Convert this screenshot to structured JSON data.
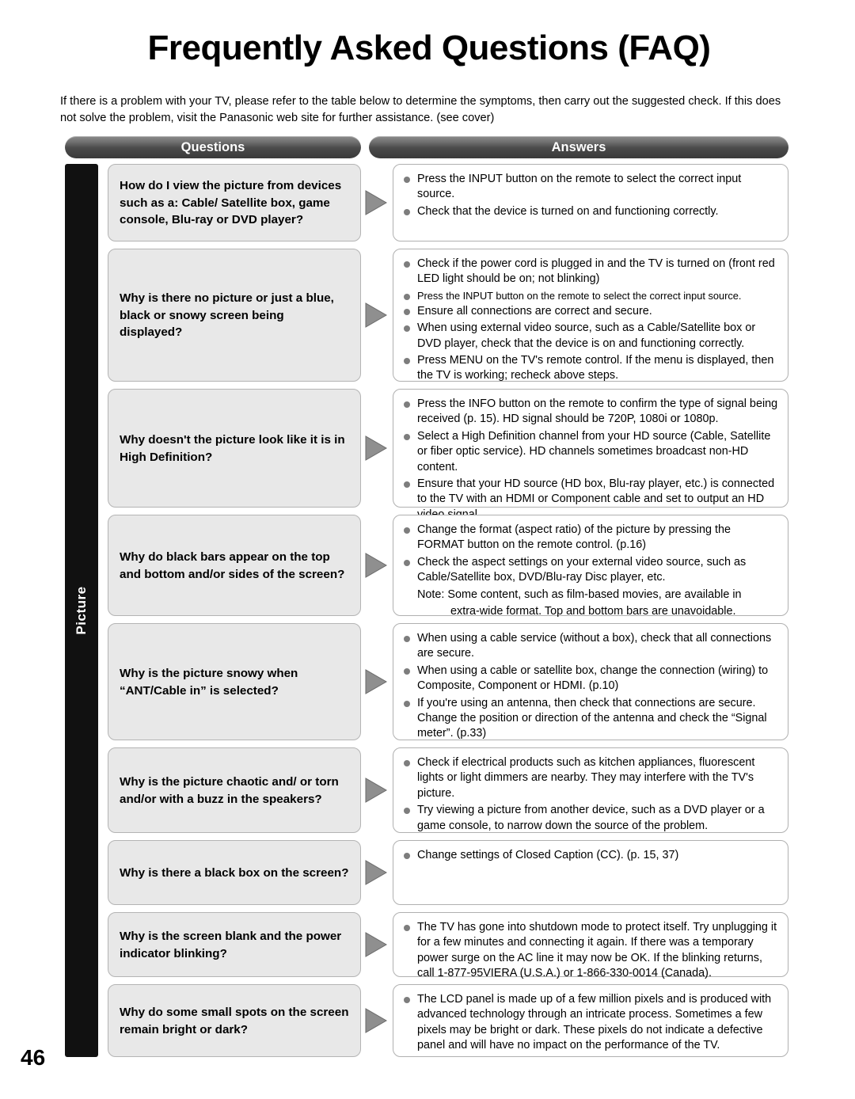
{
  "page": {
    "title": "Frequently Asked Questions (FAQ)",
    "intro": "If there is a problem with your TV, please refer to the table below to determine the symptoms, then carry out the suggested check. If this does not solve the problem, visit the Panasonic web site for further assistance. (see cover)",
    "number": "46",
    "section_tab": "Picture",
    "col_questions": "Questions",
    "col_answers": "Answers"
  },
  "rows": [
    {
      "question": "How do I view the picture from devices such as a: Cable/ Satellite box,  game console, Blu-ray or DVD player?",
      "answers": [
        {
          "text": "Press the INPUT button on the remote to select the correct input source."
        },
        {
          "text": "Check that the device is turned on and functioning correctly."
        }
      ]
    },
    {
      "question": "Why is there no picture or just a blue, black or snowy screen being displayed?",
      "answers": [
        {
          "text": "Check if the power cord is plugged in and the TV is turned on (front red LED light should be on; not blinking)"
        },
        {
          "text": "Press the INPUT button on the remote to select the correct input source.",
          "small": true
        },
        {
          "text": "Ensure all connections are correct and secure."
        },
        {
          "text": "When using external video source, such as a Cable/Satellite box or DVD player, check that the device is on and functioning correctly."
        },
        {
          "text": "Press MENU on the TV's remote control. If the menu is displayed, then the TV is working; recheck above steps."
        }
      ]
    },
    {
      "question": "Why doesn't the picture look like it is in High Definition?",
      "answers": [
        {
          "text": "Press the INFO button on the remote to confirm the type of signal being received (p. 15). HD signal should be 720P, 1080i or 1080p."
        },
        {
          "text": "Select a High Definition channel from your HD source (Cable, Satellite or fiber optic service). HD channels sometimes broadcast non-HD content."
        },
        {
          "text": "Ensure that your HD source (HD box, Blu-ray player, etc.) is connected to the TV with an HDMI or Component cable and set to output an HD video signal."
        }
      ]
    },
    {
      "question": "Why do black bars appear on the top and bottom and/or sides of the screen?",
      "answers": [
        {
          "text": "Change the format (aspect ratio) of the picture by pressing the FORMAT button on the remote control. (p.16)"
        },
        {
          "text": "Check the aspect settings on your external video source, such as Cable/Satellite box, DVD/Blu-ray Disc player, etc."
        },
        {
          "text": "Note: Some content, such as film-based movies, are available in",
          "nobullet": true
        },
        {
          "text": "extra-wide format. Top and bottom bars are unavoidable.",
          "nobullet": true,
          "indent": true
        }
      ]
    },
    {
      "question": "Why is the picture snowy when “ANT/Cable in” is selected?",
      "answers": [
        {
          "text": "When using a cable service (without a box), check that all connections are secure."
        },
        {
          "text": "When using a cable or satellite box, change the connection (wiring) to Composite, Component or HDMI. (p.10)"
        },
        {
          "text": "If you're using an antenna, then check that connections are secure. Change the position or direction of the antenna and check the “Signal meter”. (p.33)"
        }
      ]
    },
    {
      "question": "Why is the picture chaotic and/ or torn and/or with a buzz in the speakers?",
      "answers": [
        {
          "text": "Check if electrical products such as kitchen appliances, fluorescent lights or light dimmers are nearby. They may interfere with the TV's picture."
        },
        {
          "text": "Try viewing a picture from another device, such as a DVD player or a game console, to narrow down the source of the problem."
        }
      ]
    },
    {
      "question": "Why is there a black box on the screen?",
      "answers": [
        {
          "text": "Change settings of Closed Caption (CC). (p. 15, 37)"
        }
      ]
    },
    {
      "question": "Why is the screen blank and the power indicator blinking?",
      "answers": [
        {
          "text": "The TV has gone into shutdown mode to protect itself. Try unplugging it for a few minutes and connecting it again. If there was a temporary power surge on the AC line it may now be OK. If the blinking returns, call 1-877-95VIERA (U.S.A.) or 1-866-330-0014 (Canada)."
        }
      ]
    },
    {
      "question": "Why do some small spots on the screen remain bright or dark?",
      "answers": [
        {
          "text": "The LCD panel is made up of a few million pixels and is produced with advanced technology through an intricate process. Sometimes a few pixels may be bright or dark. These pixels do not indicate a defective panel and will have no impact on the performance of the TV."
        }
      ]
    }
  ]
}
